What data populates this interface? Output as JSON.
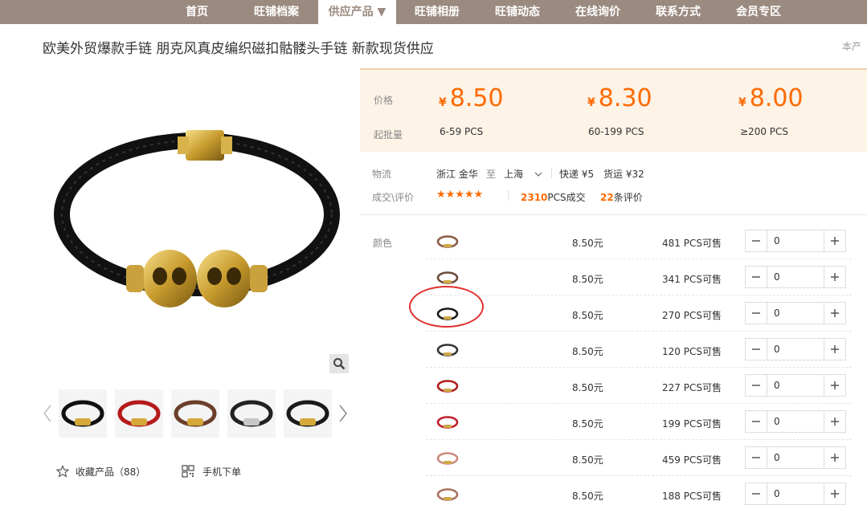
{
  "nav": {
    "items": [
      "首页",
      "旺铺档案",
      "供应产品 ▼",
      "旺铺相册",
      "旺铺动态",
      "在线询价",
      "联系方式",
      "会员专区"
    ]
  },
  "product": {
    "title": "欧美外贸爆款手链 朋克风真皮编织磁扣骷髅头手链 新款现货供应",
    "hint": "本产",
    "fav_label": "收藏产品（88）",
    "mobile_label": "手机下单"
  },
  "pricing": {
    "price_label": "价格",
    "moq_label": "起批量",
    "currency": "¥",
    "tiers": [
      {
        "price": "8.50",
        "range": "6-59 PCS"
      },
      {
        "price": "8.30",
        "range": "60-199 PCS"
      },
      {
        "price": "8.00",
        "range": "≥200 PCS"
      }
    ]
  },
  "logistics": {
    "label": "物流",
    "from": "浙江 金华",
    "to_word": "至",
    "to": "上海",
    "express": "快递 ¥5",
    "freight": "货运 ¥32"
  },
  "reviews": {
    "label": "成交\\评价",
    "stars": "★★★★★",
    "deals_count": "2310",
    "deals_unit": "PCS成交",
    "review_count": "22",
    "review_unit": "条评价"
  },
  "sku": {
    "color_label": "颜色",
    "rows": [
      {
        "price": "8.50元",
        "stock": "481 PCS可售",
        "qty": "0",
        "color": "#8a5a44"
      },
      {
        "price": "8.50元",
        "stock": "341 PCS可售",
        "qty": "0",
        "color": "#6b4a3a"
      },
      {
        "price": "8.50元",
        "stock": "270 PCS可售",
        "qty": "0",
        "color": "#1a1a1a"
      },
      {
        "price": "8.50元",
        "stock": "120 PCS可售",
        "qty": "0",
        "color": "#333333"
      },
      {
        "price": "8.50元",
        "stock": "227 PCS可售",
        "qty": "0",
        "color": "#b01c1c"
      },
      {
        "price": "8.50元",
        "stock": "199 PCS可售",
        "qty": "0",
        "color": "#c0202a"
      },
      {
        "price": "8.50元",
        "stock": "459 PCS可售",
        "qty": "0",
        "color": "#c98a7c"
      },
      {
        "price": "8.50元",
        "stock": "188 PCS可售",
        "qty": "0",
        "color": "#a8725f"
      }
    ]
  },
  "colors": {
    "nav_bg": "#9b8a7f",
    "accent": "#ff6a00",
    "annotation": "#e0302e"
  }
}
